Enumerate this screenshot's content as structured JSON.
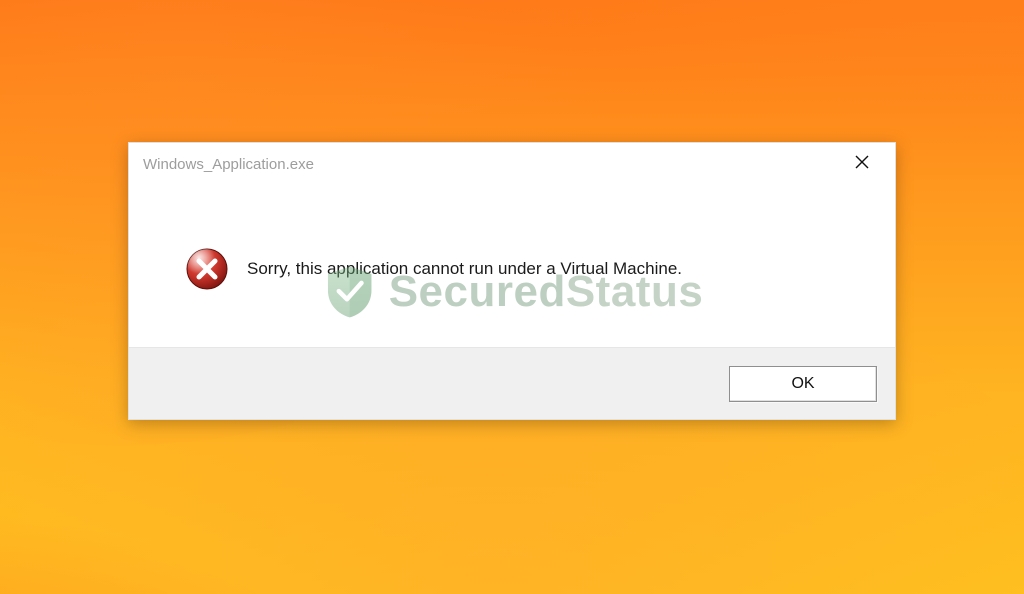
{
  "dialog": {
    "title": "Windows_Application.exe",
    "message": "Sorry, this application cannot run under a Virtual Machine.",
    "ok_label": "OK"
  },
  "watermark": {
    "text_left": "Secured",
    "text_right": "Status"
  },
  "colors": {
    "desktop_top": "#ff7818",
    "desktop_bottom": "#ffc01f",
    "error_red": "#c0392b",
    "watermark_green": "#6fa77a"
  }
}
